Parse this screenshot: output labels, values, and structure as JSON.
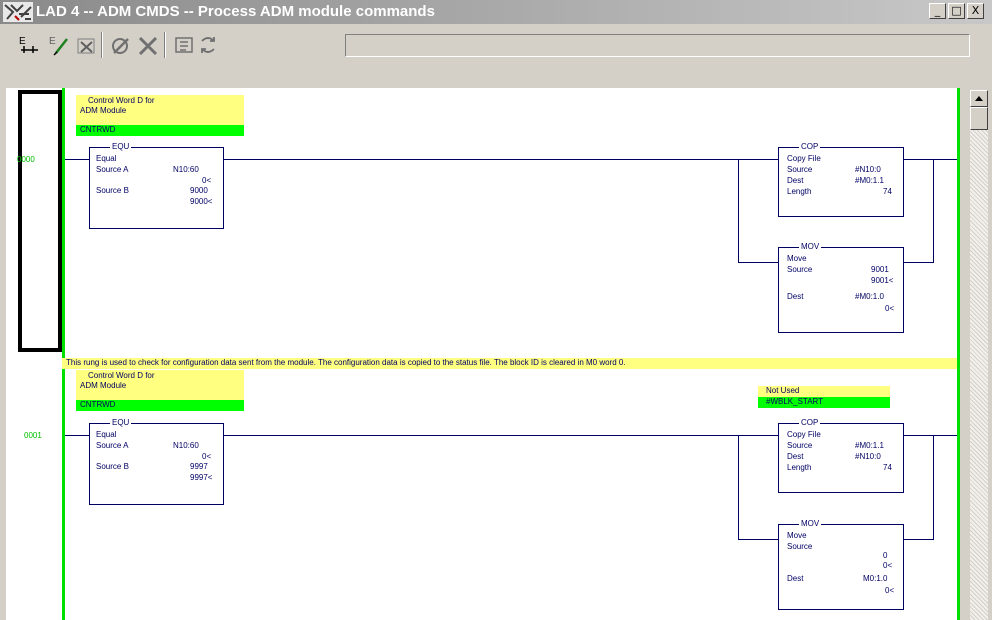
{
  "window": {
    "title": "LAD 4 -- ADM CMDS -- Process ADM module commands"
  },
  "window_buttons": {
    "minimize": "_",
    "maximize": "□",
    "close": "X"
  },
  "toolbar": {
    "icons": [
      "branch-icon",
      "edit-icon",
      "cancel-edit-icon",
      "accept-icon",
      "delete-icon",
      "test-edits-icon",
      "assemble-edits-icon"
    ]
  },
  "rungs": [
    {
      "number": "0000",
      "comment": "",
      "equ": {
        "symbol": [
          "Control Word D for",
          "ADM Module"
        ],
        "symbol_green": "CNTRWD",
        "name": "EQU",
        "op": "Equal",
        "source_a_label": "Source A",
        "source_a_value": "N10:60",
        "source_a_data": "0<",
        "source_b_label": "Source B",
        "source_b_value": "9000",
        "source_b_data": "9000<"
      },
      "cop": {
        "name": "COP",
        "op": "Copy File",
        "source_label": "Source",
        "source_value": "#N10:0",
        "dest_label": "Dest",
        "dest_value": "#M0:1.1",
        "length_label": "Length",
        "length_value": "74"
      },
      "mov": {
        "name": "MOV",
        "op": "Move",
        "source_label": "Source",
        "source_value": "9001",
        "source_data": "9001<",
        "dest_label": "Dest",
        "dest_value": "#M0:1.0",
        "dest_data": "0<"
      }
    },
    {
      "number": "0001",
      "comment": "This rung is used to check for configuration data sent from the module.  The configuration data is copied to the status file.  The block ID is cleared in M0 word 0.",
      "equ": {
        "symbol": [
          "Control Word D for",
          "ADM Module"
        ],
        "symbol_green": "CNTRWD",
        "name": "EQU",
        "op": "Equal",
        "source_a_label": "Source A",
        "source_a_value": "N10:60",
        "source_a_data": "0<",
        "source_b_label": "Source B",
        "source_b_value": "9997",
        "source_b_data": "9997<"
      },
      "cop": {
        "note": "Not Used",
        "note_green": "#WBLK_START",
        "name": "COP",
        "op": "Copy File",
        "source_label": "Source",
        "source_value": "#M0:1.1",
        "dest_label": "Dest",
        "dest_value": "#N10:0",
        "length_label": "Length",
        "length_value": "74"
      },
      "mov": {
        "name": "MOV",
        "op": "Move",
        "source_label": "Source",
        "source_value": "0",
        "source_data": "0<",
        "dest_label": "Dest",
        "dest_value": "M0:1.0",
        "dest_data": "0<"
      }
    }
  ]
}
